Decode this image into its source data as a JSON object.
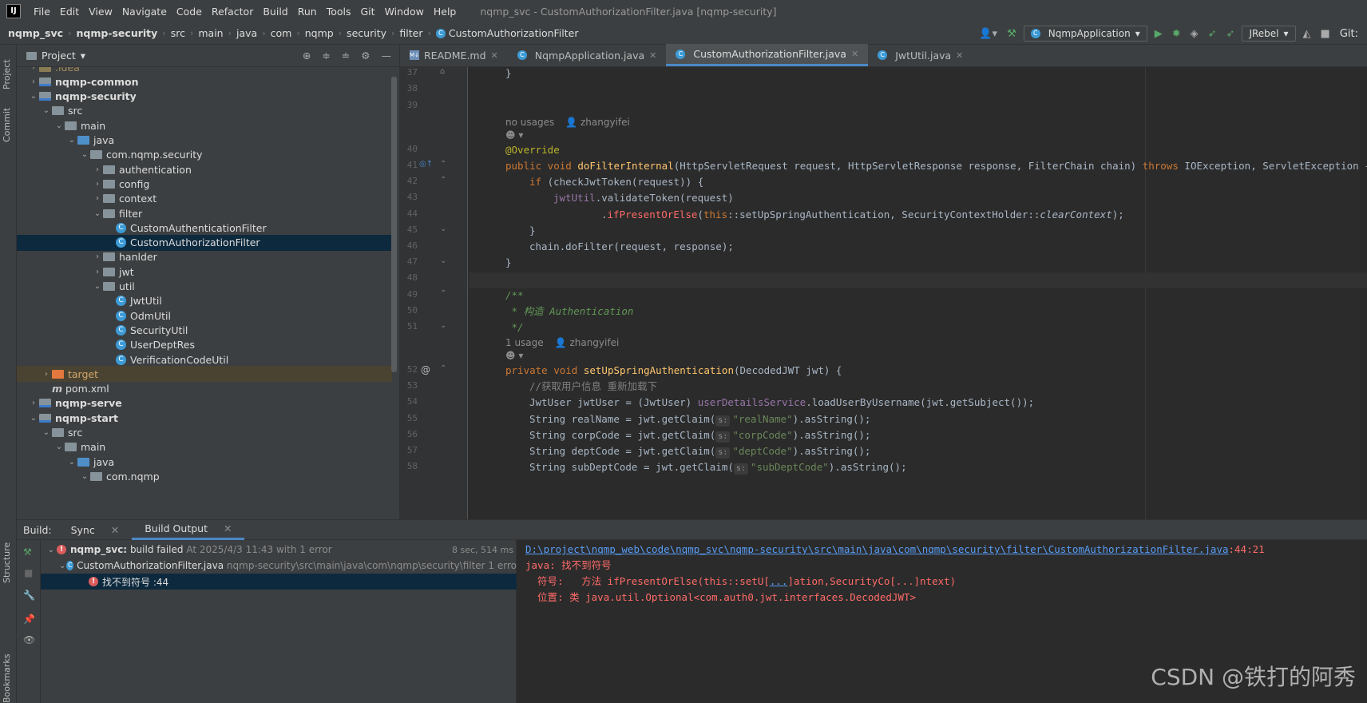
{
  "menubar": {
    "items": [
      "File",
      "Edit",
      "View",
      "Navigate",
      "Code",
      "Refactor",
      "Build",
      "Run",
      "Tools",
      "Git",
      "Window",
      "Help"
    ],
    "window_title": "nqmp_svc - CustomAuthorizationFilter.java [nqmp-security]"
  },
  "breadcrumb": [
    "nqmp_svc",
    "nqmp-security",
    "src",
    "main",
    "java",
    "com",
    "nqmp",
    "security",
    "filter",
    "CustomAuthorizationFilter"
  ],
  "toolbar": {
    "run_config": "NqmpApplication",
    "jrebel": "JRebel",
    "git_label": "Git:"
  },
  "side_tabs": {
    "project": "Project",
    "commit": "Commit",
    "structure": "Structure",
    "bookmarks": "Bookmarks"
  },
  "project_panel": {
    "title": "Project",
    "tree": [
      {
        "label": ".idea",
        "indent": 1,
        "icon": "idea",
        "arrow": "›"
      },
      {
        "label": "nqmp-common",
        "indent": 1,
        "icon": "mod",
        "arrow": "›",
        "bold": true
      },
      {
        "label": "nqmp-security",
        "indent": 1,
        "icon": "mod",
        "arrow": "⌄",
        "bold": true
      },
      {
        "label": "src",
        "indent": 2,
        "icon": "folder",
        "arrow": "⌄"
      },
      {
        "label": "main",
        "indent": 3,
        "icon": "folder",
        "arrow": "⌄"
      },
      {
        "label": "java",
        "indent": 4,
        "icon": "src",
        "arrow": "⌄"
      },
      {
        "label": "com.nqmp.security",
        "indent": 5,
        "icon": "pkg",
        "arrow": "⌄"
      },
      {
        "label": "authentication",
        "indent": 6,
        "icon": "pkg",
        "arrow": "›"
      },
      {
        "label": "config",
        "indent": 6,
        "icon": "pkg",
        "arrow": "›"
      },
      {
        "label": "context",
        "indent": 6,
        "icon": "pkg",
        "arrow": "›"
      },
      {
        "label": "filter",
        "indent": 6,
        "icon": "pkg",
        "arrow": "⌄"
      },
      {
        "label": "CustomAuthenticationFilter",
        "indent": 7,
        "icon": "class",
        "arrow": ""
      },
      {
        "label": "CustomAuthorizationFilter",
        "indent": 7,
        "icon": "class",
        "arrow": "",
        "selected": true
      },
      {
        "label": "hanlder",
        "indent": 6,
        "icon": "pkg",
        "arrow": "›"
      },
      {
        "label": "jwt",
        "indent": 6,
        "icon": "pkg",
        "arrow": "›"
      },
      {
        "label": "util",
        "indent": 6,
        "icon": "pkg",
        "arrow": "⌄"
      },
      {
        "label": "JwtUtil",
        "indent": 7,
        "icon": "class",
        "arrow": ""
      },
      {
        "label": "OdmUtil",
        "indent": 7,
        "icon": "class",
        "arrow": ""
      },
      {
        "label": "SecurityUtil",
        "indent": 7,
        "icon": "class",
        "arrow": ""
      },
      {
        "label": "UserDeptRes",
        "indent": 7,
        "icon": "class",
        "arrow": ""
      },
      {
        "label": "VerificationCodeUtil",
        "indent": 7,
        "icon": "class",
        "arrow": ""
      },
      {
        "label": "target",
        "indent": 2,
        "icon": "target",
        "arrow": "›",
        "highlight": true
      },
      {
        "label": "pom.xml",
        "indent": 2,
        "icon": "maven",
        "arrow": ""
      },
      {
        "label": "nqmp-serve",
        "indent": 1,
        "icon": "mod",
        "arrow": "›",
        "bold": true
      },
      {
        "label": "nqmp-start",
        "indent": 1,
        "icon": "mod",
        "arrow": "⌄",
        "bold": true
      },
      {
        "label": "src",
        "indent": 2,
        "icon": "folder",
        "arrow": "⌄"
      },
      {
        "label": "main",
        "indent": 3,
        "icon": "folder",
        "arrow": "⌄"
      },
      {
        "label": "java",
        "indent": 4,
        "icon": "src",
        "arrow": "⌄"
      },
      {
        "label": "com.nqmp",
        "indent": 5,
        "icon": "pkg",
        "arrow": "⌄"
      }
    ]
  },
  "editor_tabs": [
    {
      "label": "README.md",
      "type": "md",
      "active": false
    },
    {
      "label": "NqmpApplication.java",
      "type": "app",
      "active": false
    },
    {
      "label": "CustomAuthorizationFilter.java",
      "type": "class",
      "active": true
    },
    {
      "label": "JwtUtil.java",
      "type": "class",
      "active": false
    }
  ],
  "code": {
    "usages_1": "no usages",
    "author_1": "zhangyifei",
    "usages_2": "1 usage",
    "author_2": "zhangyifei",
    "line_numbers": [
      "37",
      "38",
      "39",
      "40",
      "41",
      "42",
      "43",
      "44",
      "45",
      "46",
      "47",
      "48",
      "49",
      "50",
      "51",
      "52",
      "53",
      "54",
      "55",
      "56",
      "57",
      "58"
    ],
    "l37": "}",
    "l40": "@Override",
    "l41_a": "public void ",
    "l41_b": "doFilterInternal",
    "l41_c": "(HttpServletRequest request, HttpServletResponse response, FilterChain chain) ",
    "l41_d": "throws ",
    "l41_e": "IOException, ServletException {",
    "l42_a": "if ",
    "l42_b": "(checkJwtToken(request)) {",
    "l43_a": "jwtUtil",
    "l43_b": ".validateToken(request)",
    "l44_a": ".",
    "l44_b": "ifPresentOrElse",
    "l44_c": "(",
    "l44_d": "this",
    "l44_e": "::setUpSpringAuthentication, SecurityContextHolder::",
    "l44_f": "clearContext",
    "l44_g": ");",
    "l45": "}",
    "l46": "chain.doFilter(request, response);",
    "l47": "}",
    "l49": "/**",
    "l50": " * 构造 Authentication",
    "l51": " */",
    "l52_a": "private void ",
    "l52_b": "setUpSpringAuthentication",
    "l52_c": "(DecodedJWT jwt) {",
    "l53": "//获取用户信息 重新加载下",
    "l54_a": "JwtUser jwtUser = (JwtUser) ",
    "l54_b": "userDetailsService",
    "l54_c": ".loadUserByUsername(jwt.getSubject());",
    "l55_a": "String realName = jwt.getClaim(",
    "l55_h": "s:",
    "l55_s": "\"realName\"",
    "l55_c": ").asString();",
    "l56_a": "String corpCode = jwt.getClaim(",
    "l56_h": "s:",
    "l56_s": "\"corpCode\"",
    "l56_c": ").asString();",
    "l57_a": "String deptCode = jwt.getClaim(",
    "l57_h": "s:",
    "l57_s": "\"deptCode\"",
    "l57_c": ").asString();",
    "l58_a": "String subDeptCode = jwt.getClaim(",
    "l58_h": "s:",
    "l58_s": "\"subDeptCode\"",
    "l58_c": ").asString();"
  },
  "build": {
    "label": "Build:",
    "tab_sync": "Sync",
    "tab_output": "Build Output",
    "root_name": "nqmp_svc:",
    "root_status": "build failed",
    "root_time": "At 2025/4/3 11:43 with 1 error",
    "root_duration": "8 sec, 514 ms",
    "file_name": "CustomAuthorizationFilter.java",
    "file_path": "nqmp-security\\src\\main\\java\\com\\nqmp\\security\\filter 1 erro",
    "error_item": "找不到符号 :44",
    "out_path": "D:\\project\\nqmp_web\\code\\nqmp_svc\\nqmp-security\\src\\main\\java\\com\\nqmp\\security\\filter\\CustomAuthorizationFilter.java",
    "out_loc": ":44:21",
    "out_l2": "java: 找不到符号",
    "out_l3_a": "  符号:   方法 ifPresentOrElse(this::setU[",
    "out_l3_link": "...",
    "out_l3_b": "]ation,SecurityCo[...]ntext)",
    "out_l4": "  位置: 类 java.util.Optional<com.auth0.jwt.interfaces.DecodedJWT>"
  },
  "watermark": "CSDN @铁打的阿秀",
  "colors": {
    "accent": "#4a88c7",
    "selection": "#0d293e",
    "error": "#ff6b68",
    "keyword": "#cc7832",
    "string": "#6a8759"
  }
}
